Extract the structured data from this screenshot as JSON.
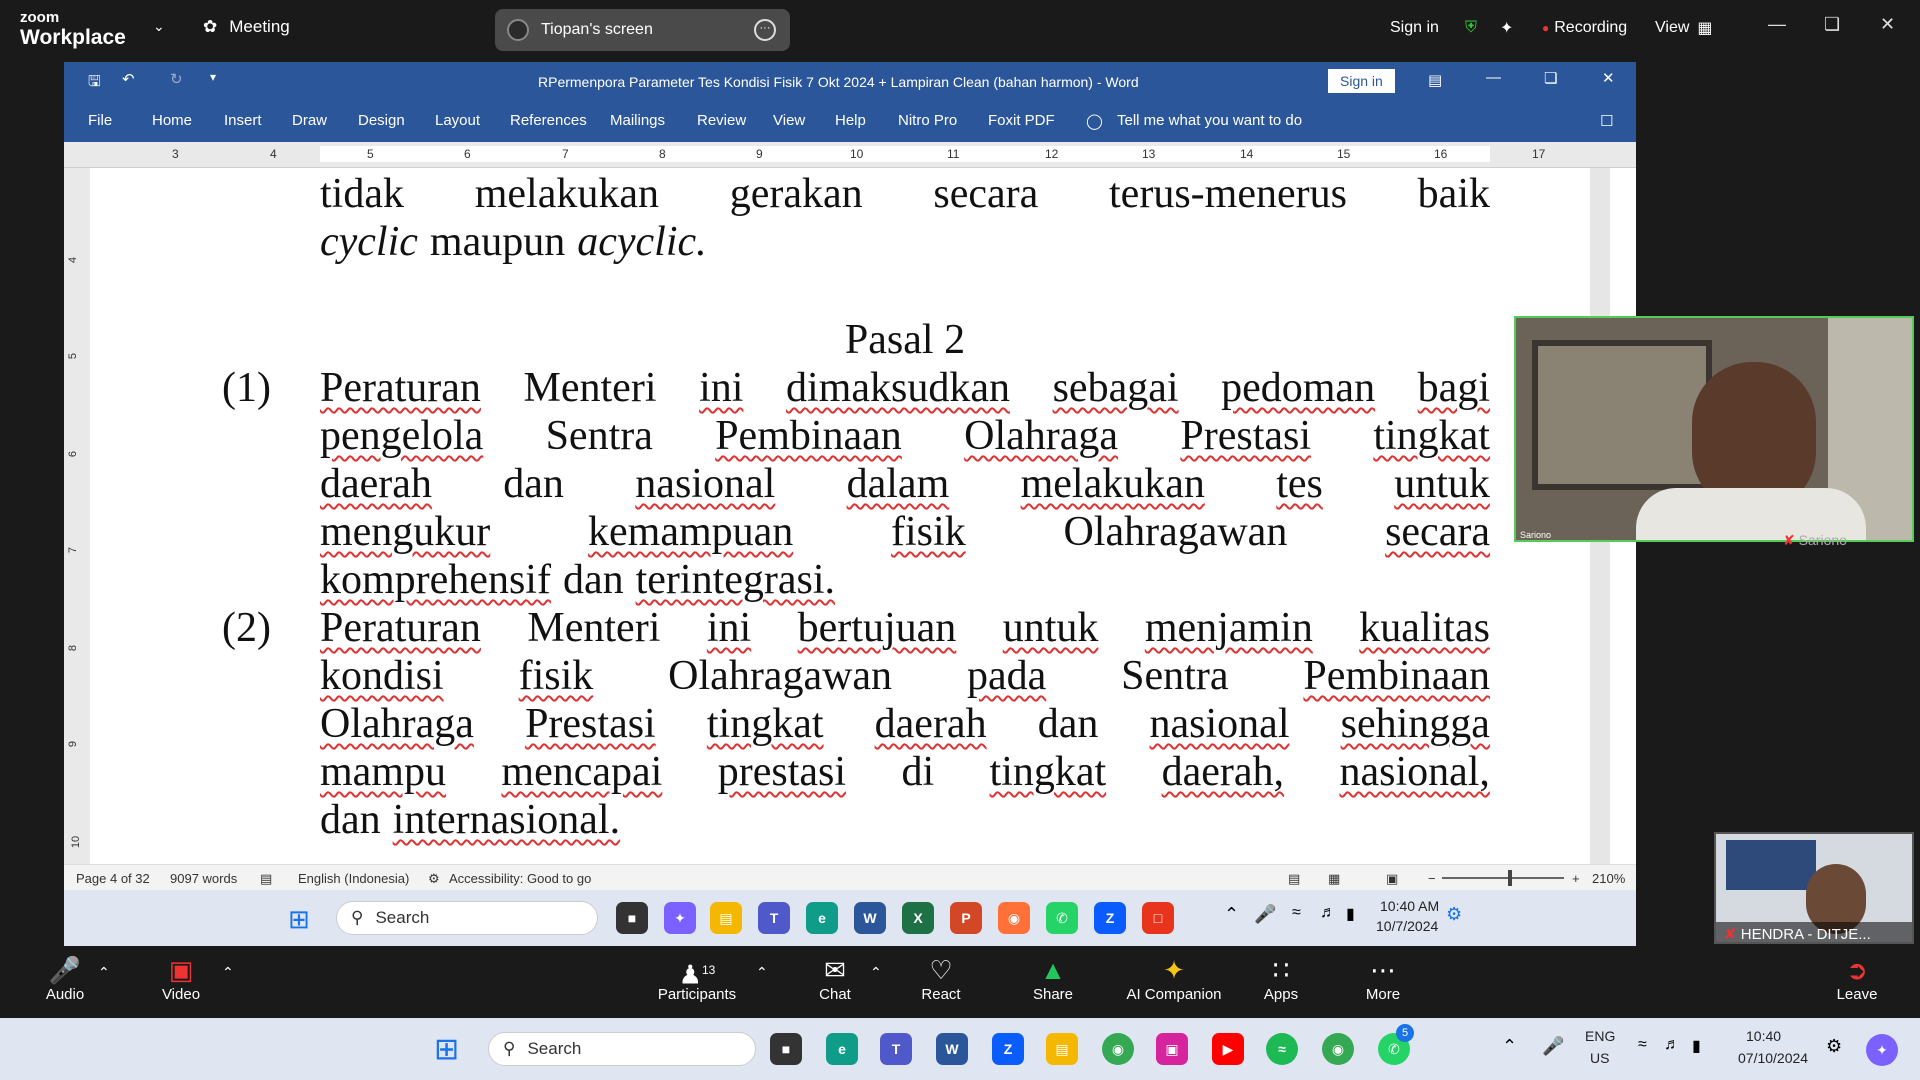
{
  "zoom": {
    "logo_top": "zoom",
    "logo_bottom": "Workplace",
    "meeting_label": "Meeting",
    "screen_label": "Tiopan's screen",
    "sign_in": "Sign in",
    "recording": "Recording",
    "view": "View"
  },
  "word": {
    "title": "RPermenpora Parameter Tes Kondisi Fisik 7 Okt 2024 + Lampiran Clean (bahan harmon)  -  Word",
    "sign_in": "Sign in",
    "menu": [
      "File",
      "Home",
      "Insert",
      "Draw",
      "Design",
      "Layout",
      "References",
      "Mailings",
      "Review",
      "View",
      "Help",
      "Nitro Pro",
      "Foxit PDF"
    ],
    "tell_me": "Tell me what you want to do",
    "ruler_h": [
      "3",
      "4",
      "5",
      "6",
      "7",
      "8",
      "9",
      "10",
      "11",
      "12",
      "13",
      "14",
      "15",
      "16",
      "17"
    ],
    "ruler_v": [
      "4",
      "5",
      "6",
      "7",
      "8",
      "9",
      "10"
    ],
    "status": {
      "page": "Page 4 of 32",
      "words": "9097 words",
      "language": "English (Indonesia)",
      "accessibility": "Accessibility: Good to go",
      "zoom": "210%"
    }
  },
  "doc": {
    "l1": [
      "tidak",
      "melakukan",
      "gerakan",
      "secara",
      "terus-menerus",
      "baik"
    ],
    "l2_a": "cyclic",
    "l2_b": "maupun",
    "l2_c": "acyclic.",
    "heading": "Pasal 2",
    "n1": "(1)",
    "n2": "(2)",
    "p1": [
      [
        "Peraturan",
        "Menteri",
        "ini",
        "dimaksudkan",
        "sebagai",
        "pedoman",
        "bagi"
      ],
      [
        "pengelola",
        "Sentra",
        "Pembinaan",
        "Olahraga",
        "Prestasi",
        "tingkat"
      ],
      [
        "daerah",
        "dan",
        "nasional",
        "dalam",
        "melakukan",
        "tes",
        "untuk"
      ],
      [
        "mengukur",
        "kemampuan",
        "fisik",
        "Olahragawan",
        "secara"
      ],
      [
        "komprehensif",
        "dan",
        "terintegrasi."
      ]
    ],
    "p2": [
      [
        "Peraturan",
        "Menteri",
        "ini",
        "bertujuan",
        "untuk",
        "menjamin",
        "kualitas"
      ],
      [
        "kondisi",
        "fisik",
        "Olahragawan",
        "pada",
        "Sentra",
        "Pembinaan"
      ],
      [
        "Olahraga",
        "Prestasi",
        "tingkat",
        "daerah",
        "dan",
        "nasional",
        "sehingga"
      ],
      [
        "mampu",
        "mencapai",
        "prestasi",
        "di",
        "tingkat",
        "daerah,",
        "nasional,"
      ],
      [
        "dan",
        "internasional."
      ]
    ]
  },
  "inner_taskbar": {
    "search": "Search",
    "time": "10:40 AM",
    "date": "10/7/2024"
  },
  "videos": {
    "v1_name": "Sariono",
    "v1_label": "Sariono",
    "v2_name": "HENDRA - DITJE..."
  },
  "zoom_controls": {
    "audio": "Audio",
    "video": "Video",
    "participants": "Participants",
    "participants_count": "13",
    "chat": "Chat",
    "react": "React",
    "share": "Share",
    "ai": "AI Companion",
    "apps": "Apps",
    "more": "More",
    "leave": "Leave"
  },
  "outer_taskbar": {
    "search": "Search",
    "lang1": "ENG",
    "lang2": "US",
    "time": "10:40",
    "date": "07/10/2024",
    "whatsapp_badge": "5"
  }
}
